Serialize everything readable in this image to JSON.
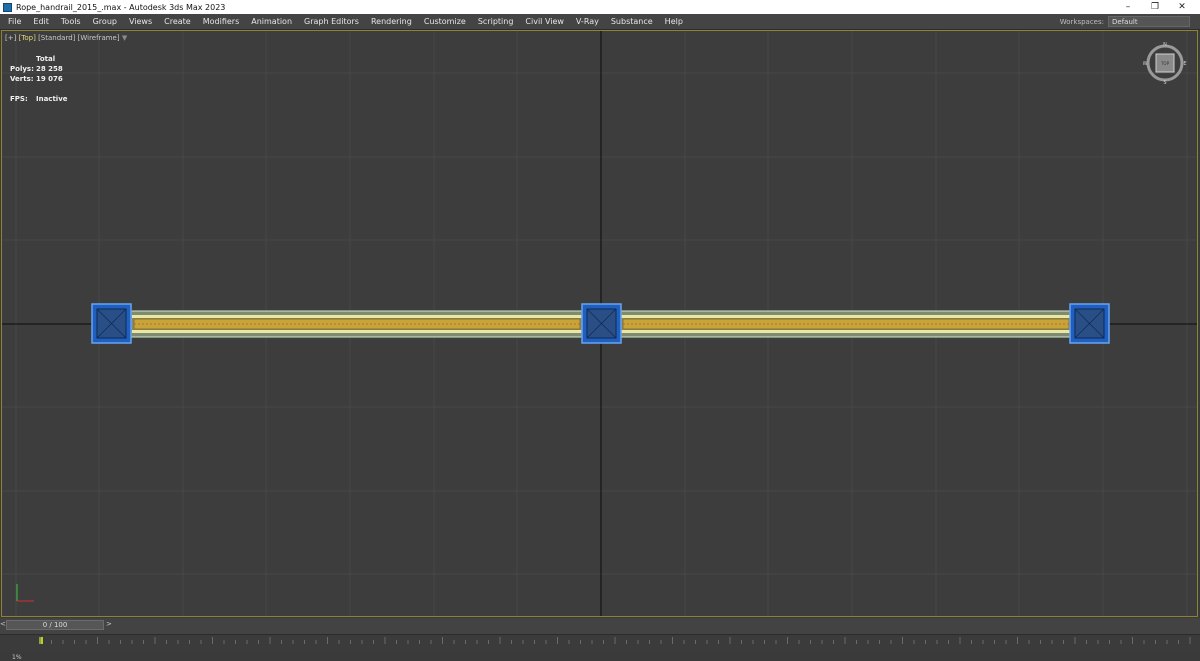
{
  "window": {
    "title": "Rope_handrail_2015_.max - Autodesk 3ds Max 2023",
    "controls": [
      "–",
      "❐",
      "✕"
    ]
  },
  "menu": [
    "File",
    "Edit",
    "Tools",
    "Group",
    "Views",
    "Create",
    "Modifiers",
    "Animation",
    "Graph Editors",
    "Rendering",
    "Customize",
    "Scripting",
    "Civil View",
    "V-Ray",
    "Substance",
    "Help"
  ],
  "workspace": {
    "label": "Workspaces:",
    "value": "Default"
  },
  "viewport": {
    "label_plus": "[+]",
    "label_view": "[Top]",
    "label_shading": "[Standard]",
    "label_mode": "[Wireframe]",
    "stats": {
      "total_label": "Total",
      "polys_label": "Polys:",
      "polys_value": "28 258",
      "verts_label": "Verts:",
      "verts_value": "19 076",
      "fps_label": "FPS:",
      "fps_value": "Inactive"
    },
    "viewcube": {
      "n": "N",
      "w": "W",
      "e": "E",
      "s": "S",
      "face": "TOP"
    }
  },
  "timeline": {
    "slider_text": "0 / 100",
    "coord_label": "1%"
  },
  "colors": {
    "accent": "#8f8135",
    "rope": "#c9a23a",
    "rail_fill": "#e6e69a",
    "post": "#1f5fbf"
  }
}
